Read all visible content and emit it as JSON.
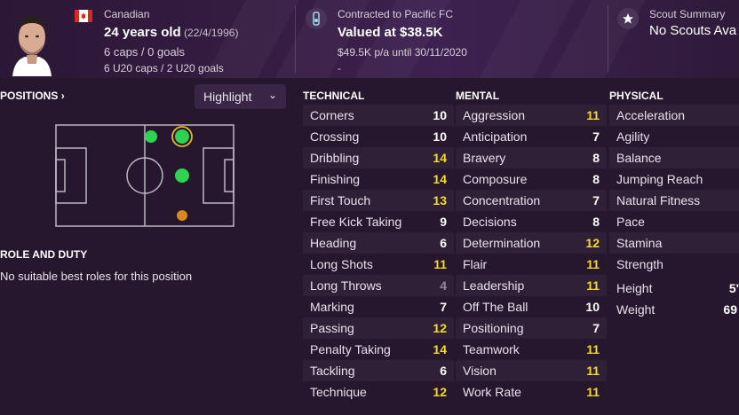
{
  "header": {
    "nationality": "Canadian",
    "age": "24 years old",
    "dob": "(22/4/1996)",
    "caps": "6 caps / 0 goals",
    "u20_caps": "6 U20 caps / 2 U20 goals",
    "contract": "Contracted to Pacific FC",
    "value": "Valued at $38.5K",
    "wage": "$49.5K p/a until 30/11/2020",
    "dash": "-",
    "scout_title": "Scout Summary",
    "scout_text": "No Scouts Ava"
  },
  "positions": {
    "title": "POSITIONS",
    "chevron": "›",
    "highlight_label": "Highlight",
    "highlight_chevron": "⌄"
  },
  "role": {
    "title": "ROLE AND DUTY",
    "text": "No suitable best roles for this position"
  },
  "technical": {
    "title": "TECHNICAL",
    "rows": [
      {
        "name": "Corners",
        "value": "10"
      },
      {
        "name": "Crossing",
        "value": "10"
      },
      {
        "name": "Dribbling",
        "value": "14"
      },
      {
        "name": "Finishing",
        "value": "14"
      },
      {
        "name": "First Touch",
        "value": "13"
      },
      {
        "name": "Free Kick Taking",
        "value": "9"
      },
      {
        "name": "Heading",
        "value": "6"
      },
      {
        "name": "Long Shots",
        "value": "11"
      },
      {
        "name": "Long Throws",
        "value": "4"
      },
      {
        "name": "Marking",
        "value": "7"
      },
      {
        "name": "Passing",
        "value": "12"
      },
      {
        "name": "Penalty Taking",
        "value": "14"
      },
      {
        "name": "Tackling",
        "value": "6"
      },
      {
        "name": "Technique",
        "value": "12"
      }
    ]
  },
  "mental": {
    "title": "MENTAL",
    "rows": [
      {
        "name": "Aggression",
        "value": "11"
      },
      {
        "name": "Anticipation",
        "value": "7"
      },
      {
        "name": "Bravery",
        "value": "8"
      },
      {
        "name": "Composure",
        "value": "8"
      },
      {
        "name": "Concentration",
        "value": "7"
      },
      {
        "name": "Decisions",
        "value": "8"
      },
      {
        "name": "Determination",
        "value": "12"
      },
      {
        "name": "Flair",
        "value": "11"
      },
      {
        "name": "Leadership",
        "value": "11"
      },
      {
        "name": "Off The Ball",
        "value": "10"
      },
      {
        "name": "Positioning",
        "value": "7"
      },
      {
        "name": "Teamwork",
        "value": "11"
      },
      {
        "name": "Vision",
        "value": "11"
      },
      {
        "name": "Work Rate",
        "value": "11"
      }
    ]
  },
  "physical": {
    "title": "PHYSICAL",
    "rows": [
      {
        "name": "Acceleration"
      },
      {
        "name": "Agility"
      },
      {
        "name": "Balance"
      },
      {
        "name": "Jumping Reach"
      },
      {
        "name": "Natural Fitness"
      },
      {
        "name": "Pace"
      },
      {
        "name": "Stamina"
      },
      {
        "name": "Strength"
      }
    ],
    "height_label": "Height",
    "height_value": "5'",
    "weight_label": "Weight",
    "weight_value": "69"
  },
  "colors": {
    "background": "#26162e",
    "value_white": "#ffffff",
    "value_yellow": "#f2da2e",
    "value_grey": "#8f8895",
    "position_green": "#2fd34f",
    "position_orange": "#d98a1e"
  }
}
